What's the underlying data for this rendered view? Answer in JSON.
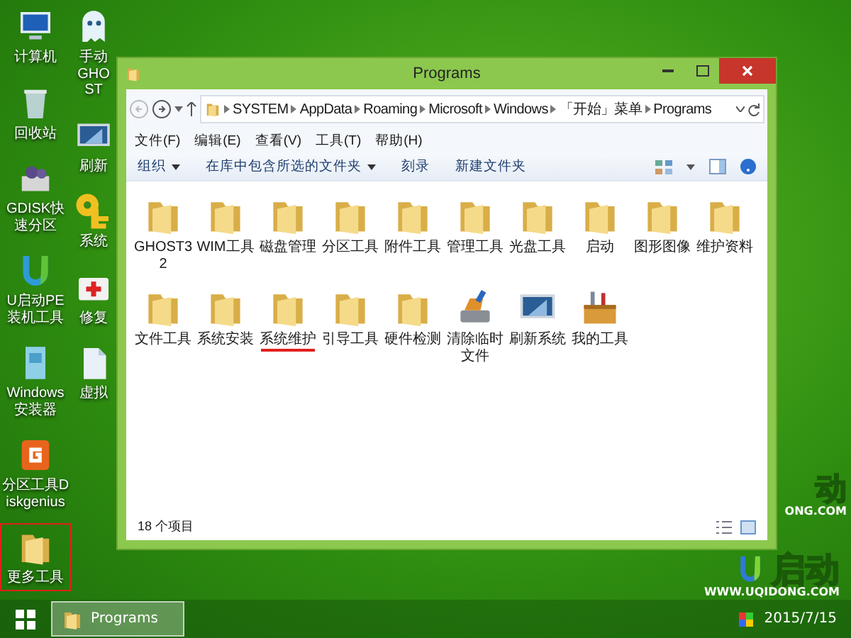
{
  "desktop_icons": [
    [
      {
        "label": "计算机",
        "kind": "computer",
        "highlighted": false
      },
      {
        "label": "回收站",
        "kind": "recycle",
        "highlighted": false
      },
      {
        "label": "GDISK快速分区",
        "kind": "gears",
        "highlighted": false
      },
      {
        "label": "U启动PE装机工具",
        "kind": "ulogo",
        "highlighted": false
      },
      {
        "label": "Windows安装器",
        "kind": "setup",
        "highlighted": false
      },
      {
        "label": "分区工具Diskgenius",
        "kind": "diskgenius",
        "highlighted": false
      },
      {
        "label": "更多工具",
        "kind": "folder",
        "highlighted": true
      }
    ],
    [
      {
        "label": "手动GHOST",
        "kind": "ghost",
        "highlighted": false
      },
      {
        "label": "刷新",
        "kind": "monitor",
        "highlighted": false
      },
      {
        "label": "系统",
        "kind": "key",
        "highlighted": false
      },
      {
        "label": "修复",
        "kind": "firstaid",
        "highlighted": false
      },
      {
        "label": "虚拟",
        "kind": "document",
        "highlighted": false
      }
    ]
  ],
  "wallpaper": {
    "upper_logo_text": "动",
    "upper_url": "ONG.COM",
    "logo_text": "启动",
    "url": "WWW.UQIDONG.COM"
  },
  "window": {
    "title": "Programs",
    "address": [
      "SYSTEM",
      "AppData",
      "Roaming",
      "Microsoft",
      "Windows",
      "「开始」菜单",
      "Programs"
    ],
    "menu": [
      "文件(F)",
      "编辑(E)",
      "查看(V)",
      "工具(T)",
      "帮助(H)"
    ],
    "toolbar": [
      {
        "label": "组织",
        "dropdown": true
      },
      {
        "label": "在库中包含所选的文件夹",
        "dropdown": true
      },
      {
        "label": "刻录",
        "dropdown": false
      },
      {
        "label": "新建文件夹",
        "dropdown": false
      }
    ],
    "items": [
      {
        "label": "GHOST32",
        "kind": "folder",
        "underlined": false
      },
      {
        "label": "WIM工具",
        "kind": "folder",
        "underlined": false
      },
      {
        "label": "磁盘管理",
        "kind": "folder",
        "underlined": false
      },
      {
        "label": "分区工具",
        "kind": "folder",
        "underlined": false
      },
      {
        "label": "附件工具",
        "kind": "folder",
        "underlined": false
      },
      {
        "label": "管理工具",
        "kind": "folder",
        "underlined": false
      },
      {
        "label": "光盘工具",
        "kind": "folder",
        "underlined": false
      },
      {
        "label": "启动",
        "kind": "folder",
        "underlined": false
      },
      {
        "label": "图形图像",
        "kind": "folder",
        "underlined": false
      },
      {
        "label": "维护资料",
        "kind": "folder",
        "underlined": false
      },
      {
        "label": "文件工具",
        "kind": "folder",
        "underlined": false
      },
      {
        "label": "系统安装",
        "kind": "folder",
        "underlined": false
      },
      {
        "label": "系统维护",
        "kind": "folder",
        "underlined": true
      },
      {
        "label": "引导工具",
        "kind": "folder",
        "underlined": false
      },
      {
        "label": "硬件检测",
        "kind": "folder",
        "underlined": false
      },
      {
        "label": "清除临时文件",
        "kind": "cleaner",
        "underlined": false
      },
      {
        "label": "刷新系统",
        "kind": "monitor",
        "underlined": false
      },
      {
        "label": "我的工具",
        "kind": "toolbox",
        "underlined": false
      }
    ],
    "status": "18 个项目"
  },
  "taskbar": {
    "tasks": [
      {
        "label": "Programs",
        "selected": true
      }
    ],
    "date": "2015/7/15"
  }
}
